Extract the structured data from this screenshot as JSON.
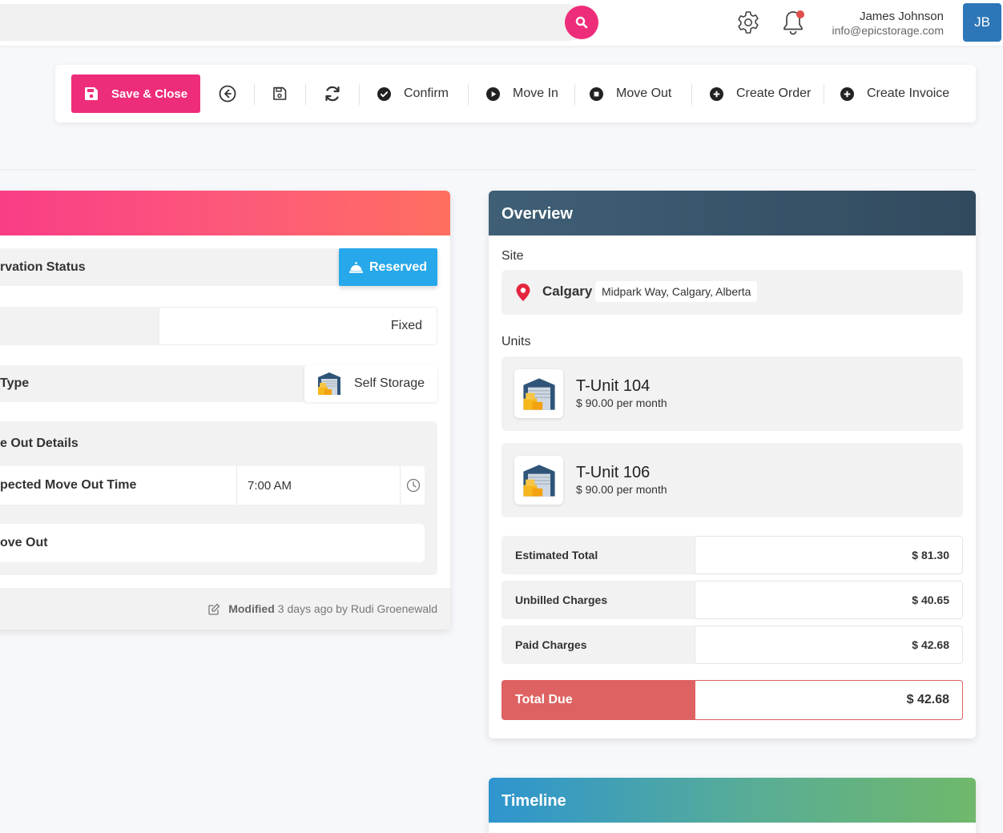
{
  "header": {
    "search_value": "",
    "user_name": "James Johnson",
    "user_email": "info@epicstorage.com",
    "avatar_initials": "JB"
  },
  "toolbar": {
    "save_close": "Save & Close",
    "confirm": "Confirm",
    "move_in": "Move In",
    "move_out": "Move Out",
    "create_order": "Create Order",
    "create_invoice": "Create Invoice"
  },
  "reservation": {
    "status_label": "rvation Status",
    "status_value": "Reserved",
    "rate_value": "Fixed",
    "type_label": "Type",
    "type_value": "Self Storage",
    "move_out_details_label": "e Out Details",
    "expected_time_label": "pected Move Out Time",
    "expected_time_value": "7:00 AM",
    "move_out_label": "ove Out",
    "modified_label": "Modified",
    "modified_text": "3 days ago by Rudi Groenewald"
  },
  "overview": {
    "title": "Overview",
    "site_label": "Site",
    "site_name": "Calgary",
    "site_address": "Midpark Way, Calgary, Alberta",
    "units_label": "Units",
    "units": [
      {
        "name": "T-Unit 104",
        "price": "$ 90.00 per month"
      },
      {
        "name": "T-Unit 106",
        "price": "$ 90.00 per month"
      }
    ],
    "charges": [
      {
        "label": "Estimated Total",
        "value": "$ 81.30"
      },
      {
        "label": "Unbilled Charges",
        "value": "$ 40.65"
      },
      {
        "label": "Paid Charges",
        "value": "$ 42.68"
      }
    ],
    "total_due_label": "Total Due",
    "total_due_value": "$ 42.68"
  },
  "timeline": {
    "title": "Timeline"
  },
  "colors": {
    "primary_pink": "#ee2d7a",
    "reserved_blue": "#27a8ea",
    "overview_header": "#324a5e",
    "total_due_red": "#de6262",
    "avatar_blue": "#2d76b7"
  }
}
